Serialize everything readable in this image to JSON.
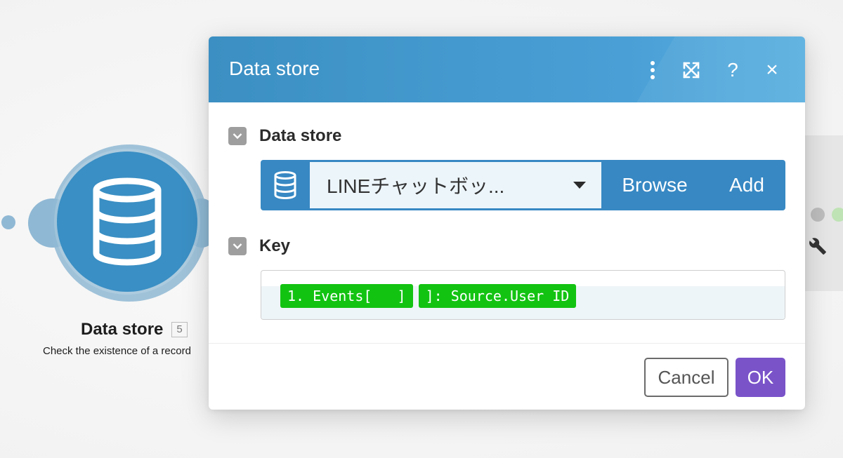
{
  "dialog": {
    "title": "Data store",
    "header_icons": [
      "more-vertical-icon",
      "expand-icon",
      "help-icon",
      "close-icon"
    ],
    "help_label": "?",
    "close_label": "×",
    "sections": {
      "data_store": {
        "label": "Data store",
        "selected_value": "LINEチャットボッ...",
        "browse_label": "Browse",
        "add_label": "Add"
      },
      "key": {
        "label": "Key",
        "pills": [
          "1. Events[   ]",
          "]: Source.User ID"
        ]
      }
    },
    "footer": {
      "cancel_label": "Cancel",
      "ok_label": "OK"
    }
  },
  "canvas": {
    "node": {
      "title": "Data store",
      "badge": "5",
      "subtitle": "Check the existence of a record"
    }
  },
  "colors": {
    "header_blue": "#3b8fc2",
    "control_blue": "#3788c3",
    "pill_green": "#13c312",
    "ok_purple": "#7a53c9"
  }
}
